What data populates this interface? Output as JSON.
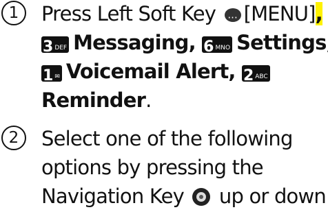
{
  "step1": {
    "number": "1",
    "line1": {
      "text_a": "Press Left Soft Key",
      "menu": "[MENU]",
      "comma": ","
    },
    "line2": {
      "key3_digit": "3",
      "key3_letters": "DEF",
      "messaging": "Messaging,",
      "key6_digit": "6",
      "key6_letters": "MNO",
      "settings": "Settings,"
    },
    "line3": {
      "key1_digit": "1",
      "voicemail": "Voicemail Alert,",
      "key2_digit": "2",
      "key2_letters": "ABC"
    },
    "line4": {
      "reminder": "Reminder",
      "period": "."
    }
  },
  "step2": {
    "number": "2",
    "line1": "Select one of the following",
    "line2": "options by pressing the",
    "line3": {
      "text_a": "Navigation Key",
      "text_b": "up or down:"
    }
  },
  "colors": {
    "highlight": "#fff200",
    "key_bg": "#111111"
  },
  "icons": {
    "soft_key": "left-soft-key-icon",
    "nav_key": "navigation-key-icon",
    "voicemail_key": "voicemail-symbol-icon"
  }
}
